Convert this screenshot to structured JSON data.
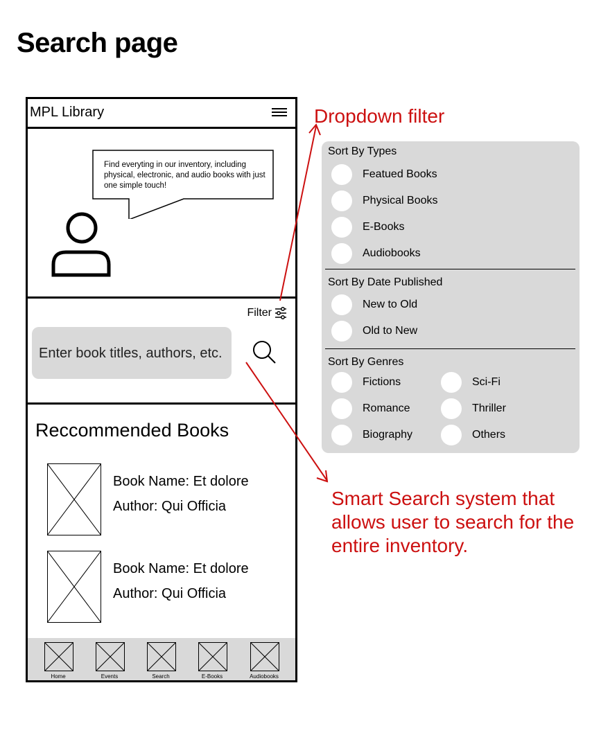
{
  "page": {
    "title": "Search page"
  },
  "app": {
    "title": "MPL Library",
    "hero_text": "Find everyting in our inventory, including physical, electronic, and audio books with just one simple touch!",
    "filter_label": "Filter",
    "search_placeholder": "Enter book titles, authors, etc.",
    "recommended_title": "Reccommended Books",
    "books": [
      {
        "name": "Book Name: Et dolore",
        "author": "Author: Qui Officia"
      },
      {
        "name": "Book Name: Et dolore",
        "author": "Author: Qui Officia"
      }
    ],
    "nav": [
      "Home",
      "Events",
      "Search",
      "E-Books",
      "Audiobooks"
    ]
  },
  "annotations": {
    "dropdown": "Dropdown filter",
    "smart_search": "Smart Search system that allows user to search for the entire inventory.",
    "color": "#cc1010"
  },
  "filter_panel": {
    "types_title": "Sort By Types",
    "types": [
      "Featued Books",
      "Physical Books",
      "E-Books",
      "Audiobooks"
    ],
    "date_title": "Sort By Date Published",
    "date": [
      "New to Old",
      "Old to New"
    ],
    "genres_title": "Sort By Genres",
    "genres_left": [
      "Fictions",
      "Romance",
      "Biography"
    ],
    "genres_right": [
      "Sci-Fi",
      "Thriller",
      "Others"
    ]
  }
}
